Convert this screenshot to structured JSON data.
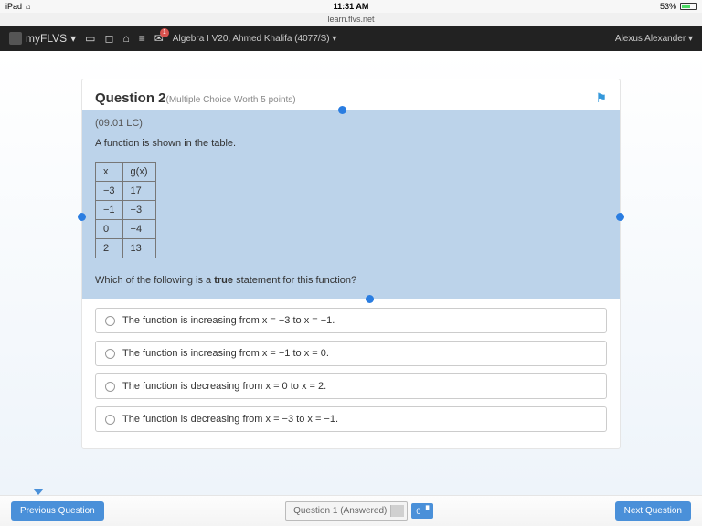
{
  "status": {
    "device": "iPad",
    "time": "11:31 AM",
    "battery": "53%",
    "url": "learn.flvs.net"
  },
  "nav": {
    "brand": "myFLVS",
    "course": "Algebra I V20, Ahmed Khalifa (4077/S)",
    "user": "Alexus Alexander",
    "badge": "1"
  },
  "question": {
    "number": "Question 2",
    "meta": "(Multiple Choice Worth 5 points)",
    "code": "(09.01 LC)",
    "prompt": "A function is shown in the table.",
    "table": {
      "h1": "x",
      "h2": "g(x)",
      "rows": [
        [
          "−3",
          "17"
        ],
        [
          "−1",
          "−3"
        ],
        [
          "0",
          "−4"
        ],
        [
          "2",
          "13"
        ]
      ]
    },
    "stem_pre": "Which of the following is a ",
    "stem_bold": "true",
    "stem_post": " statement for this function?",
    "options": [
      "The function is increasing from x = −3 to x = −1.",
      "The function is increasing from x = −1 to x = 0.",
      "The function is decreasing from x = 0 to x = 2.",
      "The function is decreasing from x = −3 to x = −1."
    ]
  },
  "footer": {
    "prev": "Previous Question",
    "next": "Next Question",
    "select": "Question 1 (Answered)",
    "msgs": "0"
  }
}
